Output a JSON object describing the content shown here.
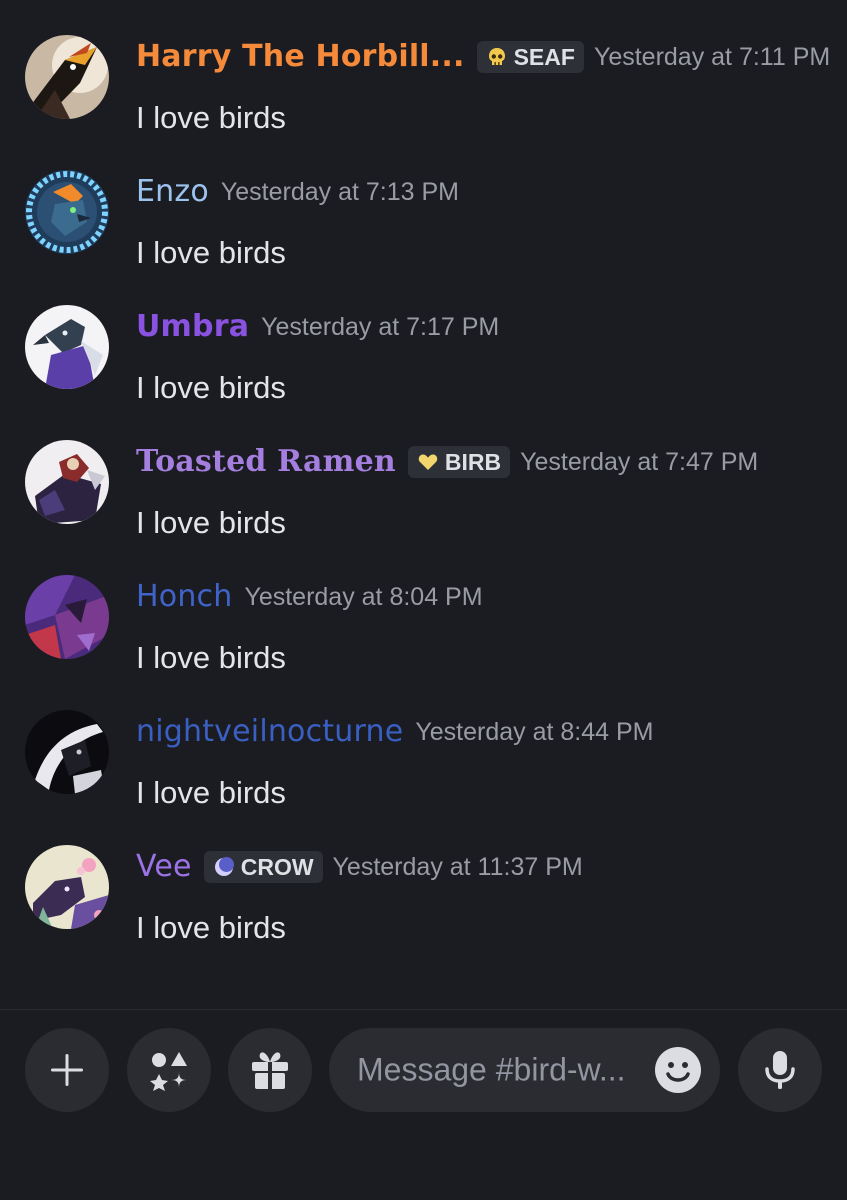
{
  "colors": {
    "background": "#1b1c21",
    "message_text": "#e4e5e9",
    "timestamp": "#9a9ca4",
    "badge_bg": "#2e3038",
    "composer_button_bg": "#2a2c32"
  },
  "messages": [
    {
      "username": "Harry The Horbill...",
      "username_color": "#f58a3a",
      "badge": {
        "icon": "skull-icon",
        "label": "SEAF"
      },
      "timestamp": "Yesterday at 7:11 PM",
      "content": "I love birds"
    },
    {
      "username": "Enzo",
      "username_color": "#9cc2ee",
      "timestamp": "Yesterday at 7:13 PM",
      "content": "I love birds"
    },
    {
      "username": "Umbra",
      "username_color": "#8a52e0",
      "timestamp": "Yesterday at 7:17 PM",
      "content": "I love birds"
    },
    {
      "username": "Toasted Ramen",
      "username_color": "#a57fe0",
      "badge": {
        "icon": "heart-icon",
        "label": "BIRB"
      },
      "timestamp": "Yesterday at 7:47 PM",
      "content": "I love birds"
    },
    {
      "username": "Honch",
      "username_color": "#3f63c8",
      "timestamp": "Yesterday at 8:04 PM",
      "content": "I love birds"
    },
    {
      "username": "nightveilnocturne",
      "username_color": "#3a5fc2",
      "timestamp": "Yesterday at 8:44 PM",
      "content": "I love birds"
    },
    {
      "username": "Vee",
      "username_color": "#9b73e6",
      "badge": {
        "icon": "crescent-moon-icon",
        "label": "CROW"
      },
      "timestamp": "Yesterday at 11:37 PM",
      "content": "I love birds"
    }
  ],
  "composer": {
    "add_icon": "plus-icon",
    "apps_icon": "apps-icon",
    "gift_icon": "gift-icon",
    "placeholder": "Message #bird-w...",
    "emoji_icon": "emoji-icon",
    "voice_icon": "microphone-icon"
  }
}
